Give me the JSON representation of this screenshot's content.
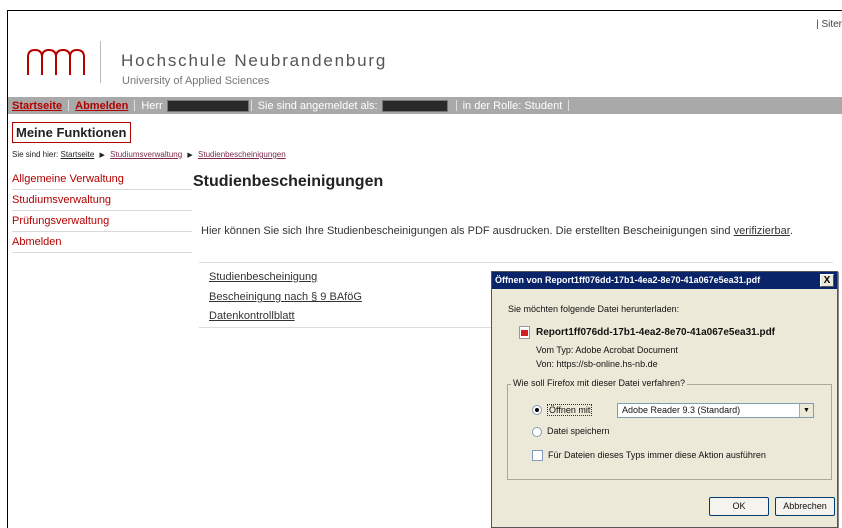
{
  "header": {
    "site_ref": "| Siter",
    "brand_title": "Hochschule Neubrandenburg",
    "brand_subtitle": "University of Applied Sciences"
  },
  "topbar": {
    "startseite": "Startseite",
    "abmelden": "Abmelden",
    "herr": "Herr",
    "logged_in_as": "Sie sind angemeldet als:",
    "role": "in der Rolle: Student"
  },
  "meine_funktionen": "Meine Funktionen",
  "breadcrumb": {
    "prefix": "Sie sind hier:",
    "items": [
      "Startseite",
      "Studiumsverwaltung",
      "Studienbescheinigungen"
    ]
  },
  "sidenav": {
    "items": [
      "Allgemeine Verwaltung",
      "Studiumsverwaltung",
      "Prüfungsverwaltung",
      "Abmelden"
    ]
  },
  "main": {
    "title": "Studienbescheinigungen",
    "intro": "Hier können Sie sich Ihre Studienbescheinigungen als PDF ausdrucken. Die erstellten Bescheinigungen sind",
    "intro_link": "verifizierbar",
    "intro_end": ".",
    "documents": [
      "Studienbescheinigung",
      "Bescheinigung nach § 9 BAföG",
      "Datenkontrollblatt"
    ]
  },
  "dialog": {
    "title": "Öffnen von Report1ff076dd-17b1-4ea2-8e70-41a067e5ea31.pdf",
    "close": "X",
    "prompt": "Sie möchten folgende Datei herunterladen:",
    "filename": "Report1ff076dd-17b1-4ea2-8e70-41a067e5ea31.pdf",
    "type_line": "Vom Typ:  Adobe Acrobat Document",
    "from_line": "Von:  https://sb-online.hs-nb.de",
    "group_label": "Wie soll Firefox mit dieser Datei verfahren?",
    "open_with_label": "Öffnen mit",
    "open_with_value": "Adobe Reader 9.3 (Standard)",
    "save_label": "Datei speichern",
    "always_label": "Für Dateien dieses Typs immer diese Aktion ausführen",
    "ok_label": "OK",
    "cancel_label": "Abbrechen"
  }
}
